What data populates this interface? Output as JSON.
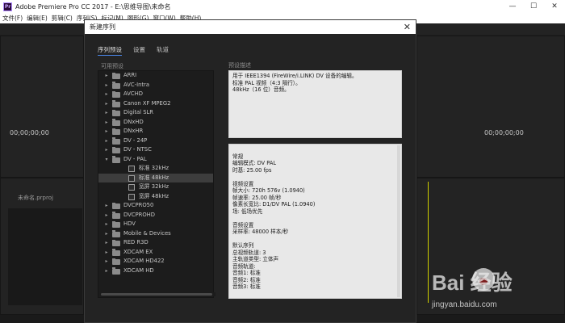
{
  "app": {
    "title": "Adobe Premiere Pro CC 2017 - E:\\思维导图\\未命名",
    "menu": [
      "文件(F)",
      "编辑(E)",
      "剪辑(C)",
      "序列(S)",
      "标记(M)",
      "图形(G)",
      "窗口(W)",
      "帮助(H)"
    ],
    "timecode_left": "00;00;00;00",
    "timecode_right": "00;00;00;00",
    "project_item": "未命名.prproj"
  },
  "dialog": {
    "title": "新建序列",
    "close_icon": "close-icon",
    "tabs": [
      "序列预设",
      "设置",
      "轨道"
    ],
    "available_presets_label": "可用预设",
    "preset_description_label": "预设描述",
    "presets": [
      {
        "name": "ARRI",
        "type": "folder",
        "expanded": false
      },
      {
        "name": "AVC-Intra",
        "type": "folder",
        "expanded": false
      },
      {
        "name": "AVCHD",
        "type": "folder",
        "expanded": false
      },
      {
        "name": "Canon XF MPEG2",
        "type": "folder",
        "expanded": false
      },
      {
        "name": "Digital SLR",
        "type": "folder",
        "expanded": false
      },
      {
        "name": "DNxHD",
        "type": "folder",
        "expanded": false
      },
      {
        "name": "DNxHR",
        "type": "folder",
        "expanded": false
      },
      {
        "name": "DV - 24P",
        "type": "folder",
        "expanded": false
      },
      {
        "name": "DV - NTSC",
        "type": "folder",
        "expanded": false
      },
      {
        "name": "DV - PAL",
        "type": "folder",
        "expanded": true
      },
      {
        "name": "标准 32kHz",
        "type": "preset"
      },
      {
        "name": "标准 48kHz",
        "type": "preset",
        "selected": true
      },
      {
        "name": "宽屏 32kHz",
        "type": "preset"
      },
      {
        "name": "宽屏 48kHz",
        "type": "preset"
      },
      {
        "name": "DVCPRO50",
        "type": "folder",
        "expanded": false
      },
      {
        "name": "DVCPROHD",
        "type": "folder",
        "expanded": false
      },
      {
        "name": "HDV",
        "type": "folder",
        "expanded": false
      },
      {
        "name": "Mobile & Devices",
        "type": "folder",
        "expanded": false
      },
      {
        "name": "RED R3D",
        "type": "folder",
        "expanded": false
      },
      {
        "name": "XDCAM EX",
        "type": "folder",
        "expanded": false
      },
      {
        "name": "XDCAM HD422",
        "type": "folder",
        "expanded": false
      },
      {
        "name": "XDCAM HD",
        "type": "folder",
        "expanded": false
      }
    ],
    "description_text": "用于 IEEE1394 (FireWire/i.LINK) DV 设备的编辑。\n标准 PAL 视频（4:3 隔行）。\n48kHz（16 位）音频。",
    "general_text": "常规\n编辑模式: DV PAL\n时基: 25.00 fps\n\n视频设置\n帧大小: 720h 576v (1.0940)\n帧速率: 25.00  帧/秒\n像素长宽比: D1/DV PAL (1.0940)\n场: 低场优先\n\n音频设置\n采样率: 48000 样本/秒\n\n默认序列\n总视频轨道: 3\n主轨道类型: 立体声\n音频轨道:\n音频1: 标准\n音频2: 标准\n音频3: 标准"
  },
  "watermark": {
    "main": "Bai 经验",
    "sub": "jingyan.baidu.com"
  }
}
